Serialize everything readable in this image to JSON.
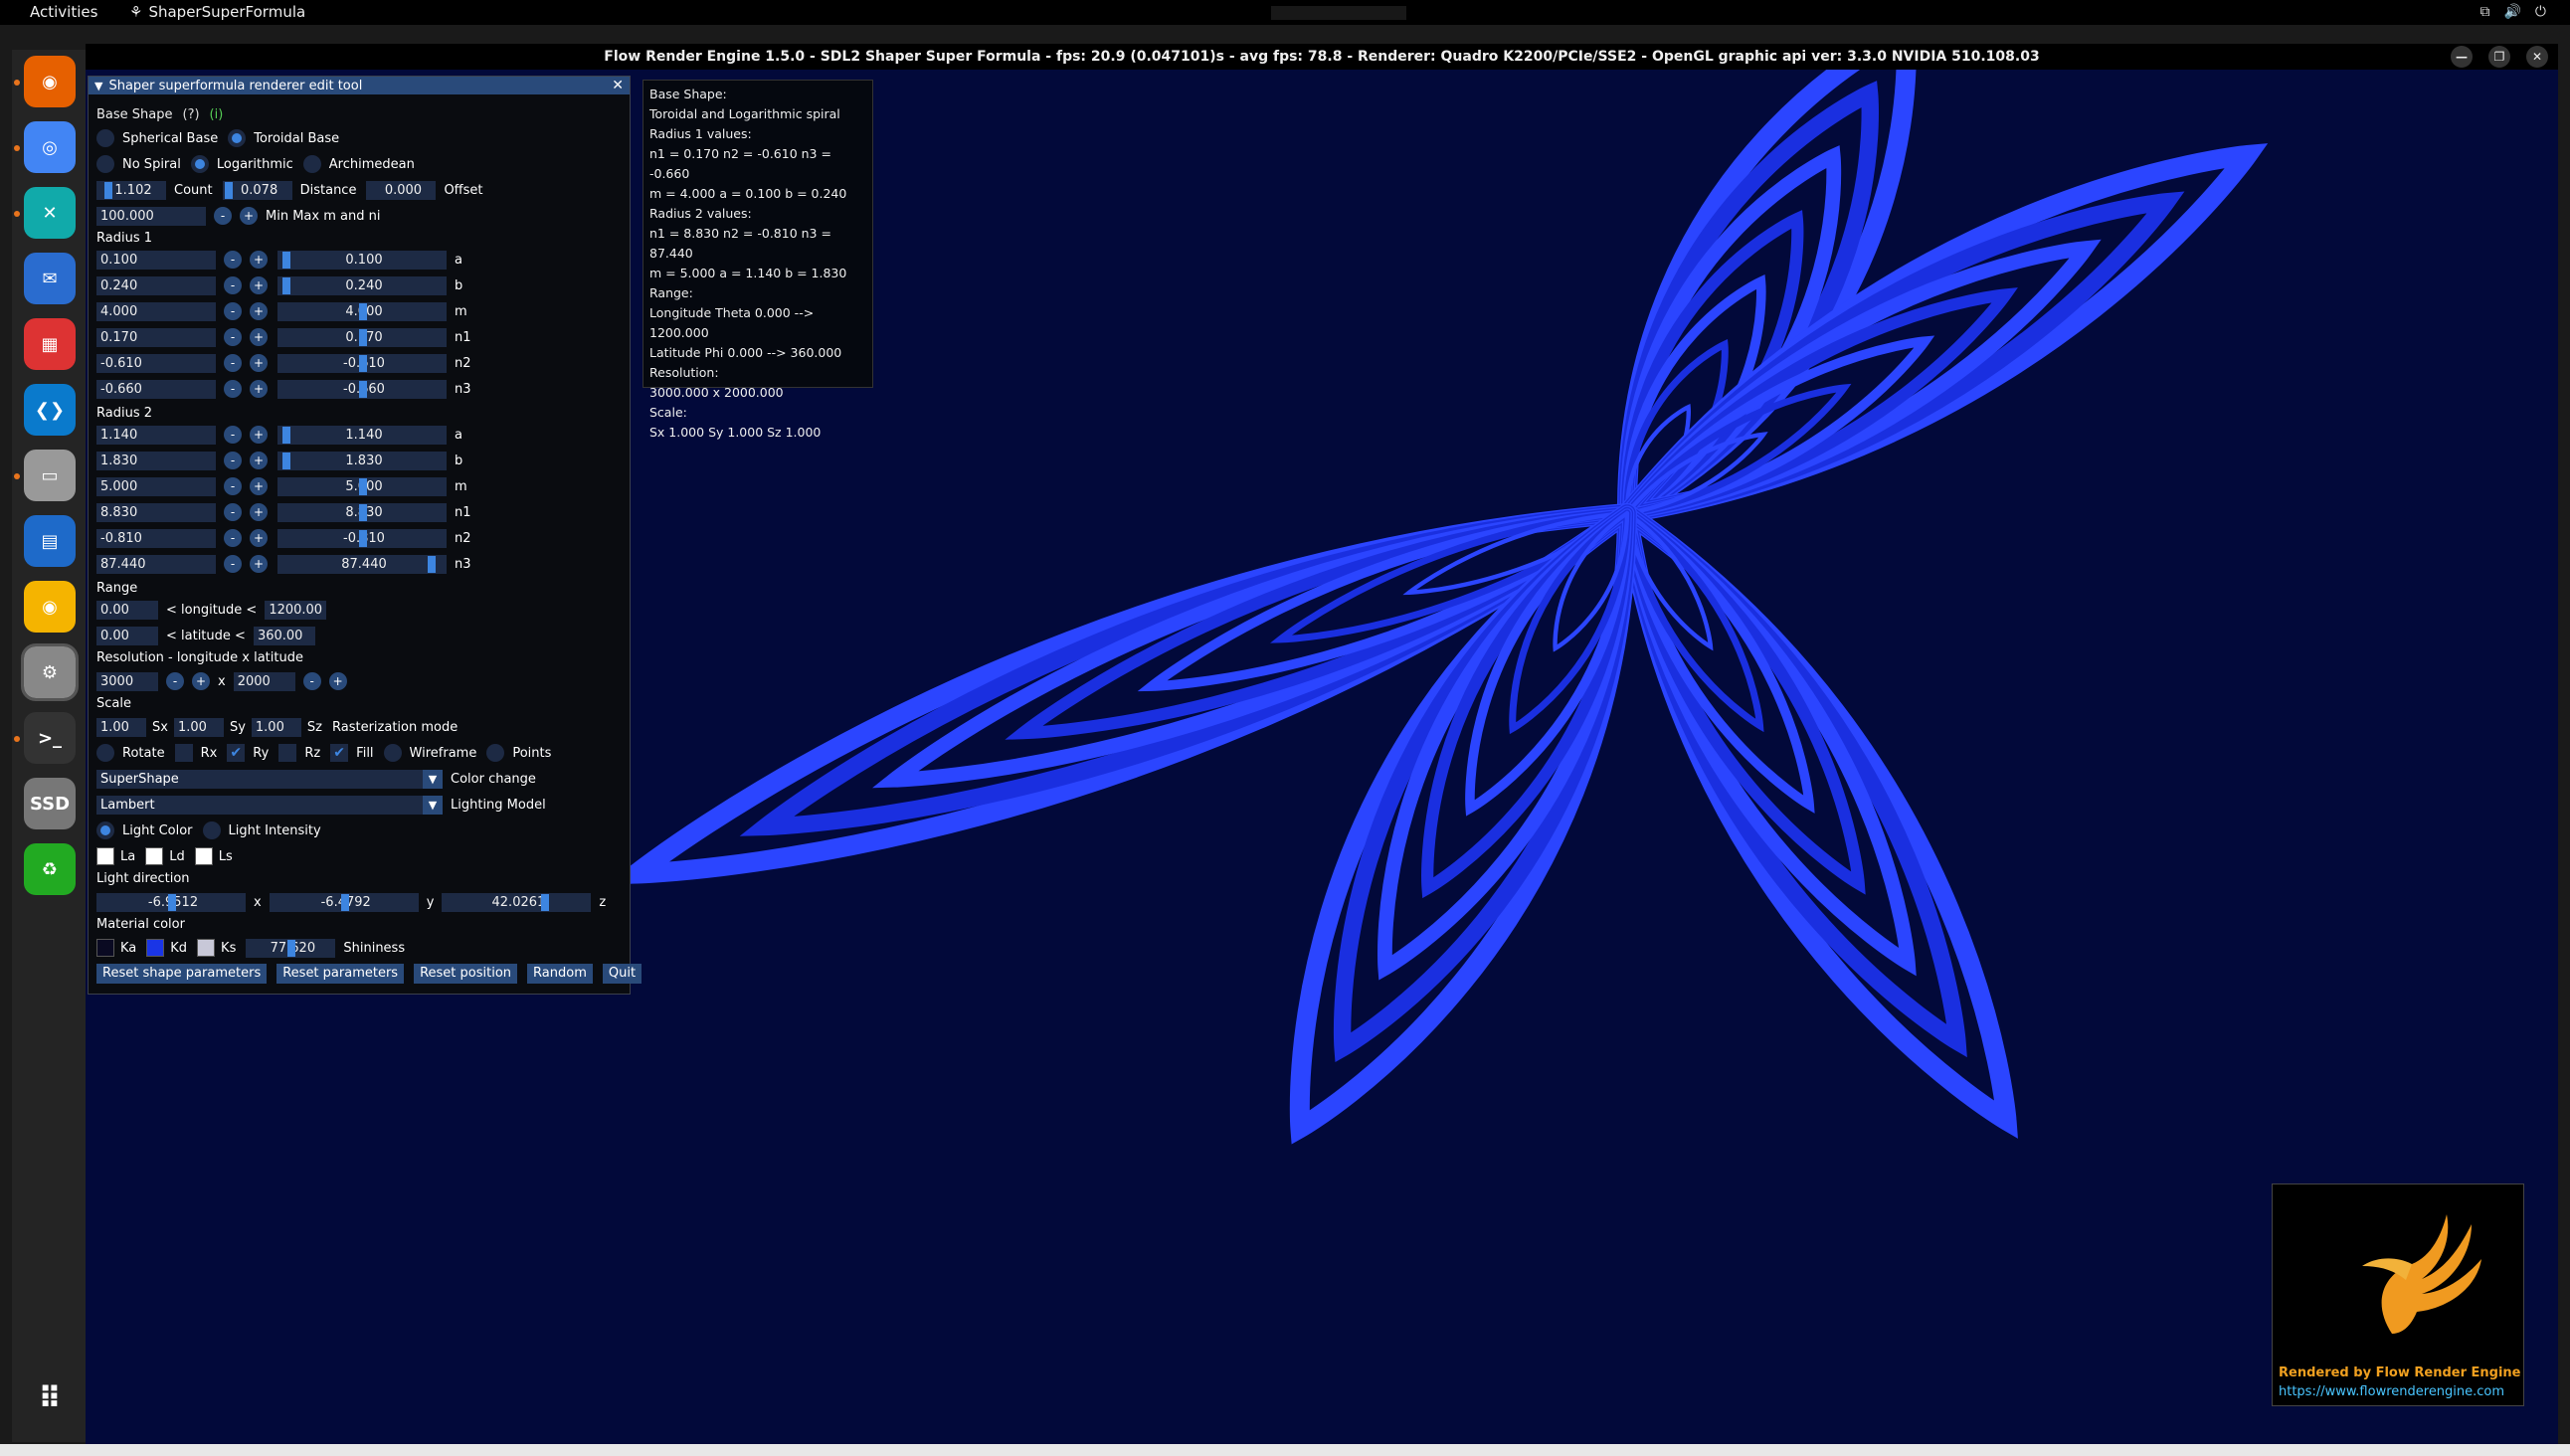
{
  "topbar": {
    "activities": "Activities",
    "app_name": "ShaperSuperFormula"
  },
  "window": {
    "title": "Flow Render Engine 1.5.0 - SDL2 Shaper Super Formula - fps: 20.9 (0.047101)s - avg fps: 78.8 - Renderer: Quadro K2200/PCIe/SSE2 - OpenGL graphic api ver: 3.3.0 NVIDIA 510.108.03"
  },
  "dock": [
    "firefox-icon",
    "chromium-icon",
    "crossover-icon",
    "thunderbird-icon",
    "color-app-icon",
    "vscode-icon",
    "files-icon",
    "writer-icon",
    "rhythmbox-icon",
    "settings-icon",
    "terminal-icon",
    "ssd-icon",
    "trash-icon",
    "apps-grid-icon"
  ],
  "panel": {
    "title": "Shaper superformula renderer edit tool",
    "base_shape": "Base Shape",
    "help": "(?)",
    "info": "(i)",
    "spherical": "Spherical Base",
    "toroidal": "Toroidal Base",
    "no_spiral": "No Spiral",
    "logarithmic": "Logarithmic",
    "archimedean": "Archimedean",
    "count_val": "1.102",
    "count_lbl": "Count",
    "dist_val": "0.078",
    "dist_lbl": "Distance",
    "offset_val": "0.000",
    "offset_lbl": "Offset",
    "minmax_val": "100.000",
    "minmax_lbl": "Min Max m and ni",
    "radius1": "Radius 1",
    "r1": [
      {
        "v": "0.100",
        "s": "0.100",
        "n": "a",
        "f": 0.02
      },
      {
        "v": "0.240",
        "s": "0.240",
        "n": "b",
        "f": 0.02
      },
      {
        "v": "4.000",
        "s": "4.000",
        "n": "m",
        "f": 0.5
      },
      {
        "v": "0.170",
        "s": "0.170",
        "n": "n1",
        "f": 0.5
      },
      {
        "v": "-0.610",
        "s": "-0.610",
        "n": "n2",
        "f": 0.5
      },
      {
        "v": "-0.660",
        "s": "-0.660",
        "n": "n3",
        "f": 0.5
      }
    ],
    "radius2": "Radius 2",
    "r2": [
      {
        "v": "1.140",
        "s": "1.140",
        "n": "a",
        "f": 0.02
      },
      {
        "v": "1.830",
        "s": "1.830",
        "n": "b",
        "f": 0.02
      },
      {
        "v": "5.000",
        "s": "5.000",
        "n": "m",
        "f": 0.5
      },
      {
        "v": "8.830",
        "s": "8.830",
        "n": "n1",
        "f": 0.5
      },
      {
        "v": "-0.810",
        "s": "-0.810",
        "n": "n2",
        "f": 0.5
      },
      {
        "v": "87.440",
        "s": "87.440",
        "n": "n3",
        "f": 0.93
      }
    ],
    "range": "Range",
    "lon_min": "0.00",
    "lon_lbl": "< longitude <",
    "lon_max": "1200.00",
    "lat_min": "0.00",
    "lat_lbl": "< latitude <",
    "lat_max": "360.00",
    "resolution": "Resolution - longitude x latitude",
    "res_lon": "3000",
    "res_x": "x",
    "res_lat": "2000",
    "scale": "Scale",
    "sx": "1.00",
    "sx_lbl": "Sx",
    "sy": "1.00",
    "sy_lbl": "Sy",
    "sz": "1.00",
    "sz_lbl": "Sz",
    "raster": "Rasterization mode",
    "rotate": "Rotate",
    "rx": "Rx",
    "ry": "Ry",
    "rz": "Rz",
    "fill": "Fill",
    "wireframe": "Wireframe",
    "points": "Points",
    "color_combo": "SuperShape",
    "color_lbl": "Color change",
    "light_combo": "Lambert",
    "light_lbl": "Lighting Model",
    "light_color": "Light Color",
    "light_intensity": "Light Intensity",
    "la": "La",
    "ld": "Ld",
    "ls": "Ls",
    "light_dir": "Light direction",
    "ldx": "-6.9512",
    "ldy": "-6.4792",
    "ldz": "42.0261",
    "x": "x",
    "y": "y",
    "z": "z",
    "material": "Material color",
    "ka": "Ka",
    "kd": "Kd",
    "ks": "Ks",
    "shininess_val": "77.620",
    "shininess_lbl": "Shininess",
    "buttons": [
      "Reset shape parameters",
      "Reset parameters",
      "Reset position",
      "Random",
      "Quit"
    ],
    "colors": {
      "ka": "#0a0a22",
      "kd": "#1a35e6",
      "ks": "#c8c8d8"
    }
  },
  "info": [
    "Base Shape:",
    "Toroidal and Logarithmic spiral",
    "Radius 1 values:",
    "n1 = 0.170 n2 = -0.610 n3 = -0.660",
    "m = 4.000 a = 0.100 b = 0.240",
    "Radius 2 values:",
    "n1 = 8.830 n2 = -0.810 n3 = 87.440",
    "m = 5.000 a = 1.140 b = 1.830",
    "Range:",
    "Longitude Theta 0.000 --> 1200.000",
    "Latitude Phi 0.000 --> 360.000",
    "Resolution:",
    "3000.000 x 2000.000",
    "Scale:",
    "Sx 1.000 Sy 1.000 Sz 1.000"
  ],
  "logo": {
    "line1": "Rendered by Flow Render Engine",
    "line2": "https://www.flowrenderengine.com"
  },
  "accent": "#3d85e0",
  "shape_color": "#1a2fe0"
}
